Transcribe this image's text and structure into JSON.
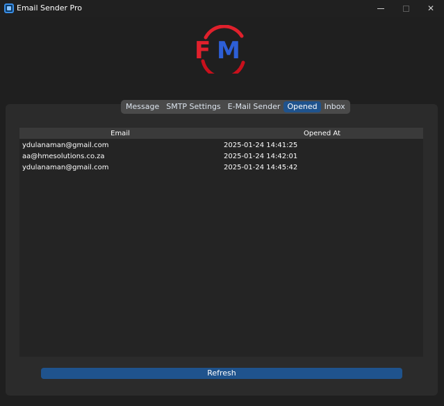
{
  "window": {
    "title": "Email Sender Pro",
    "controls": {
      "minimize_icon": "minimize-icon",
      "maximize_icon": "maximize-icon",
      "close_glyph": "✕"
    }
  },
  "logo": {
    "text_left": "F",
    "text_right": "M",
    "colors": {
      "red": "#e0202c",
      "blue": "#2d5fd6"
    }
  },
  "tabs": [
    {
      "label": "Message",
      "active": false
    },
    {
      "label": "SMTP Settings",
      "active": false
    },
    {
      "label": "E-Mail Sender",
      "active": false
    },
    {
      "label": "Opened",
      "active": true
    },
    {
      "label": "Inbox",
      "active": false
    }
  ],
  "table": {
    "headers": {
      "email": "Email",
      "opened_at": "Opened At"
    },
    "rows": [
      {
        "email": "ydulanaman@gmail.com",
        "opened_at": "2025-01-24 14:41:25"
      },
      {
        "email": "aa@hmesolutions.co.za",
        "opened_at": "2025-01-24 14:42:01"
      },
      {
        "email": "ydulanaman@gmail.com",
        "opened_at": "2025-01-24 14:45:42"
      }
    ]
  },
  "refresh_button": {
    "label": "Refresh"
  },
  "colors": {
    "accent": "#1f538d",
    "background": "#1f1f1f",
    "panel": "#2b2b2b"
  }
}
